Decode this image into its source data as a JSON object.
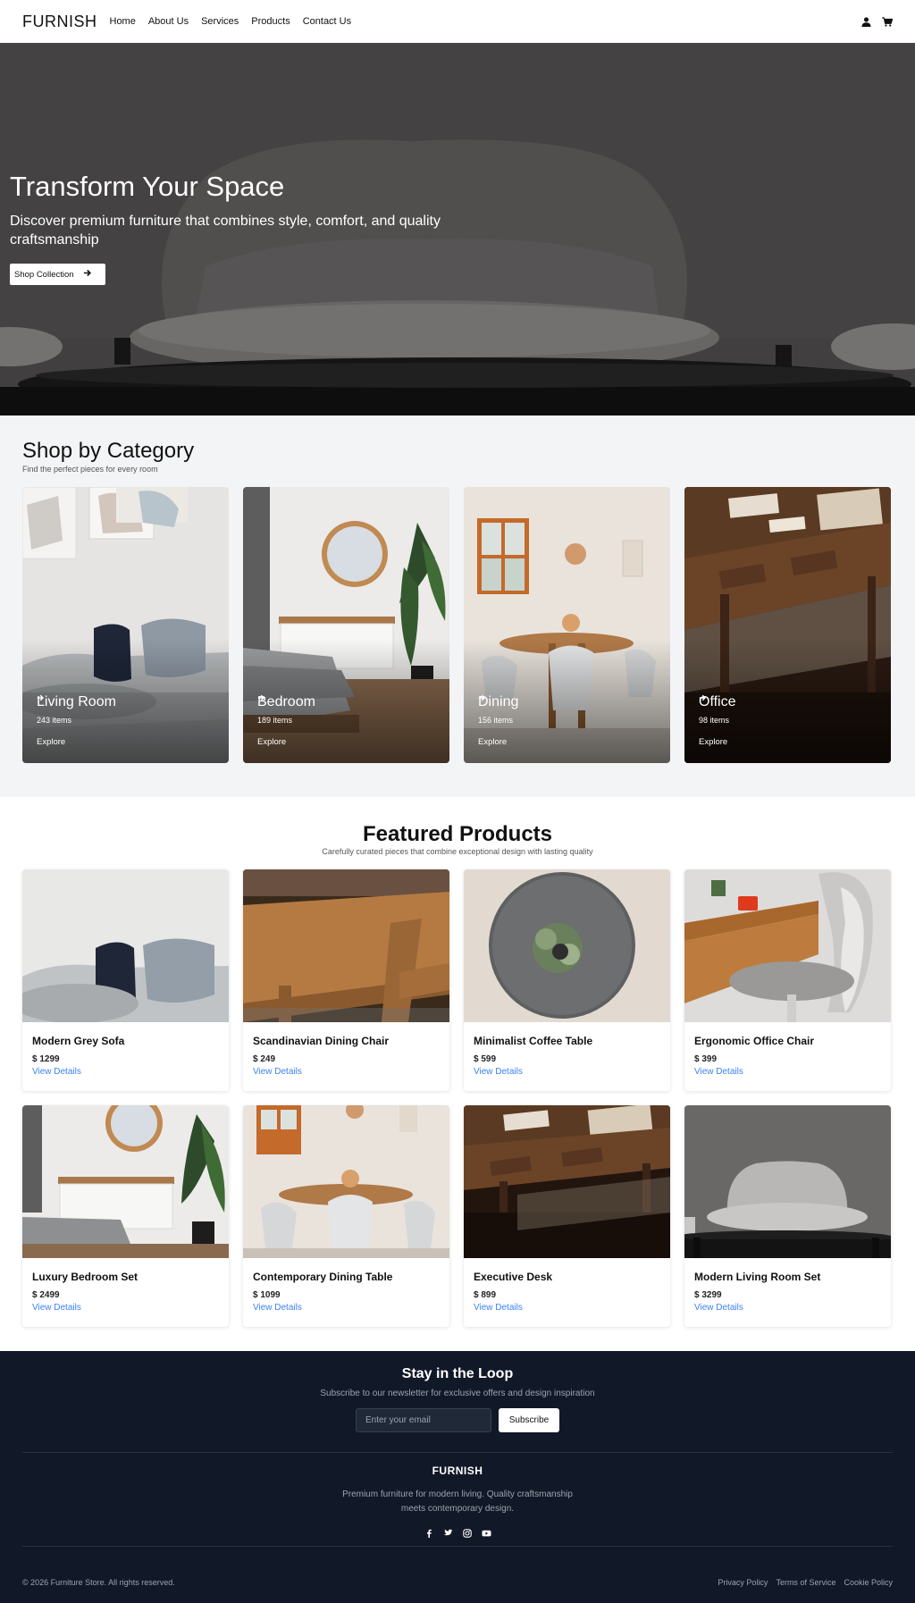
{
  "nav": {
    "brand": "FURNISH",
    "links": [
      "Home",
      "About Us",
      "Services",
      "Products",
      "Contact Us"
    ],
    "icons": [
      "user-icon",
      "cart-icon"
    ]
  },
  "hero": {
    "title": "Transform Your Space",
    "subtitle": "Discover premium furniture that combines style, comfort, and quality craftsmanship",
    "button_label": "Shop Collection"
  },
  "categories": {
    "title": "Shop by Category",
    "subtitle": "Find the perfect pieces for every room",
    "items": [
      {
        "name": "Living Room",
        "count": "243 items",
        "explore": "Explore"
      },
      {
        "name": "Bedroom",
        "count": "189 items",
        "explore": "Explore"
      },
      {
        "name": "Dining",
        "count": "156 items",
        "explore": "Explore"
      },
      {
        "name": "Office",
        "count": "98 items",
        "explore": "Explore"
      }
    ]
  },
  "featured": {
    "title": "Featured Products",
    "subtitle": "Carefully curated pieces that combine exceptional design with lasting quality",
    "products": [
      {
        "name": "Modern Grey Sofa",
        "price": "$ 1299",
        "link": "View Details"
      },
      {
        "name": "Scandinavian Dining Chair",
        "price": "$ 249",
        "link": "View Details"
      },
      {
        "name": "Minimalist Coffee Table",
        "price": "$ 599",
        "link": "View Details"
      },
      {
        "name": "Ergonomic Office Chair",
        "price": "$ 399",
        "link": "View Details"
      },
      {
        "name": "Luxury Bedroom Set",
        "price": "$ 2499",
        "link": "View Details"
      },
      {
        "name": "Contemporary Dining Table",
        "price": "$ 1099",
        "link": "View Details"
      },
      {
        "name": "Executive Desk",
        "price": "$ 899",
        "link": "View Details"
      },
      {
        "name": "Modern Living Room Set",
        "price": "$ 3299",
        "link": "View Details"
      }
    ]
  },
  "newsletter": {
    "title": "Stay in the Loop",
    "subtitle": "Subscribe to our newsletter for exclusive offers and design inspiration",
    "placeholder": "Enter your email",
    "button_label": "Subscribe"
  },
  "footer": {
    "brand": "FURNISH",
    "tagline": "Premium furniture for modern living. Quality craftsmanship meets contemporary design.",
    "social": [
      "facebook-icon",
      "twitter-icon",
      "instagram-icon",
      "youtube-icon"
    ],
    "copyright": "© 2026 Furniture Store. All rights reserved.",
    "legal": [
      "Privacy Policy",
      "Terms of Service",
      "Cookie Policy"
    ]
  },
  "colors": {
    "accent_link": "#3b82f6",
    "footer_bg": "#111827",
    "category_bg": "#f3f4f6"
  }
}
